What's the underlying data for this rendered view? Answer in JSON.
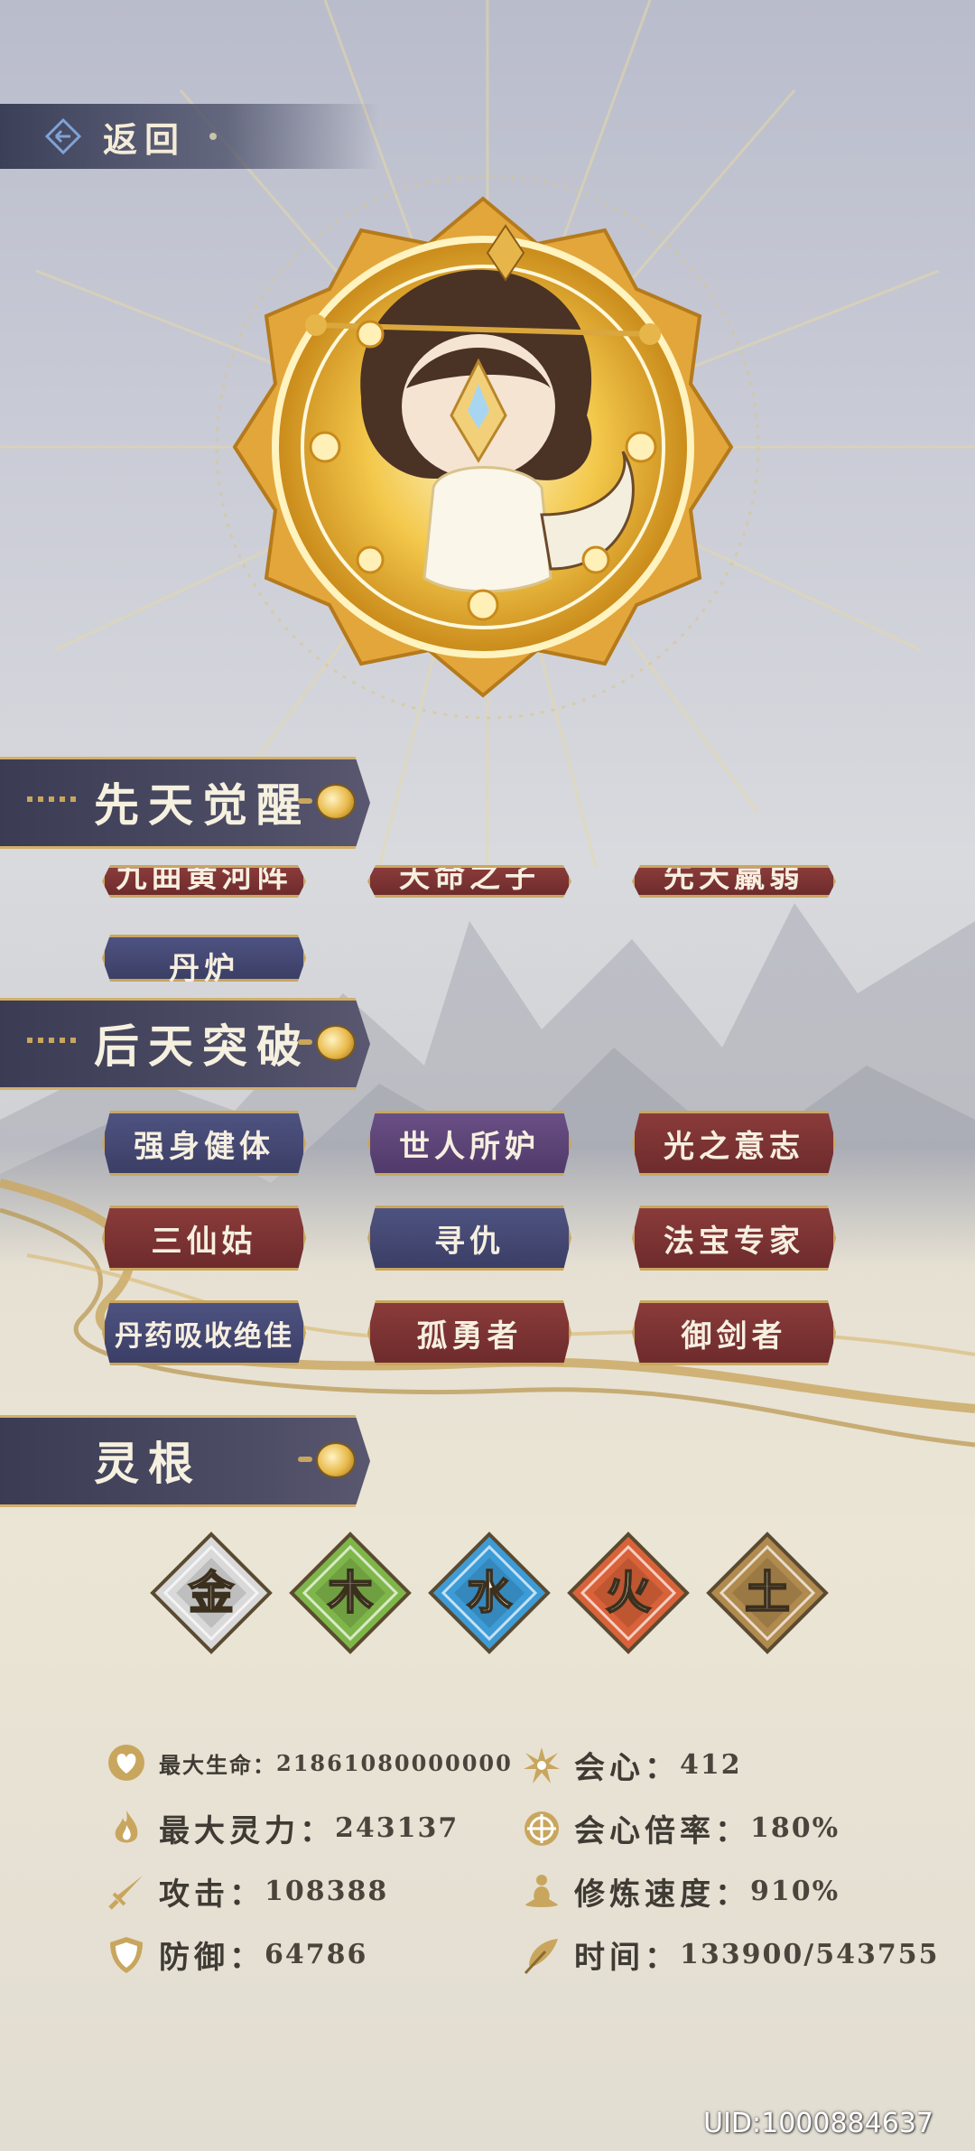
{
  "header": {
    "back_label": "返回"
  },
  "sections": {
    "innate": {
      "title": "先天觉醒",
      "partial_skills": [
        "九曲黄河阵",
        "天命之子",
        "先天羸弱"
      ],
      "skills": [
        "丹炉"
      ]
    },
    "acquired": {
      "title": "后天突破",
      "skills": [
        "强身健体",
        "世人所妒",
        "光之意志",
        "三仙姑",
        "寻仇",
        "法宝专家",
        "丹药吸收绝佳",
        "孤勇者",
        "御剑者"
      ]
    },
    "spirit_root": {
      "title": "灵根",
      "elements": [
        {
          "char": "金",
          "color": "#d9d9d9",
          "icon": "metal-element-icon"
        },
        {
          "char": "木",
          "color": "#7fb64a",
          "icon": "wood-element-icon"
        },
        {
          "char": "水",
          "color": "#3d9bd6",
          "icon": "water-element-icon"
        },
        {
          "char": "火",
          "color": "#d9623a",
          "icon": "fire-element-icon"
        },
        {
          "char": "土",
          "color": "#b08a4e",
          "icon": "earth-element-icon"
        }
      ]
    }
  },
  "stats": {
    "max_hp": {
      "label": "最大生命：",
      "value": "21861080000000",
      "icon": "heart-icon"
    },
    "max_spirit": {
      "label": "最大灵力：",
      "value": "243137",
      "icon": "flame-icon"
    },
    "attack": {
      "label": "攻击：",
      "value": "108388",
      "icon": "sword-icon"
    },
    "defense": {
      "label": "防御：",
      "value": "64786",
      "icon": "shield-icon"
    },
    "crit": {
      "label": "会心：",
      "value": "412",
      "icon": "burst-icon"
    },
    "crit_rate": {
      "label": "会心倍率：",
      "value": "180%",
      "icon": "target-icon"
    },
    "cultivation_speed": {
      "label": "修炼速度：",
      "value": "910%",
      "icon": "meditation-icon"
    },
    "time": {
      "label": "时间：",
      "value": "133900/543755",
      "icon": "feather-icon"
    }
  },
  "uid": "UID:1000884637",
  "colors": {
    "gold": "#c9a65e",
    "header_bg": "#3b3c54",
    "skill_red": "#7d3434",
    "skill_blue": "#454a74",
    "skill_purple": "#5c4478"
  }
}
